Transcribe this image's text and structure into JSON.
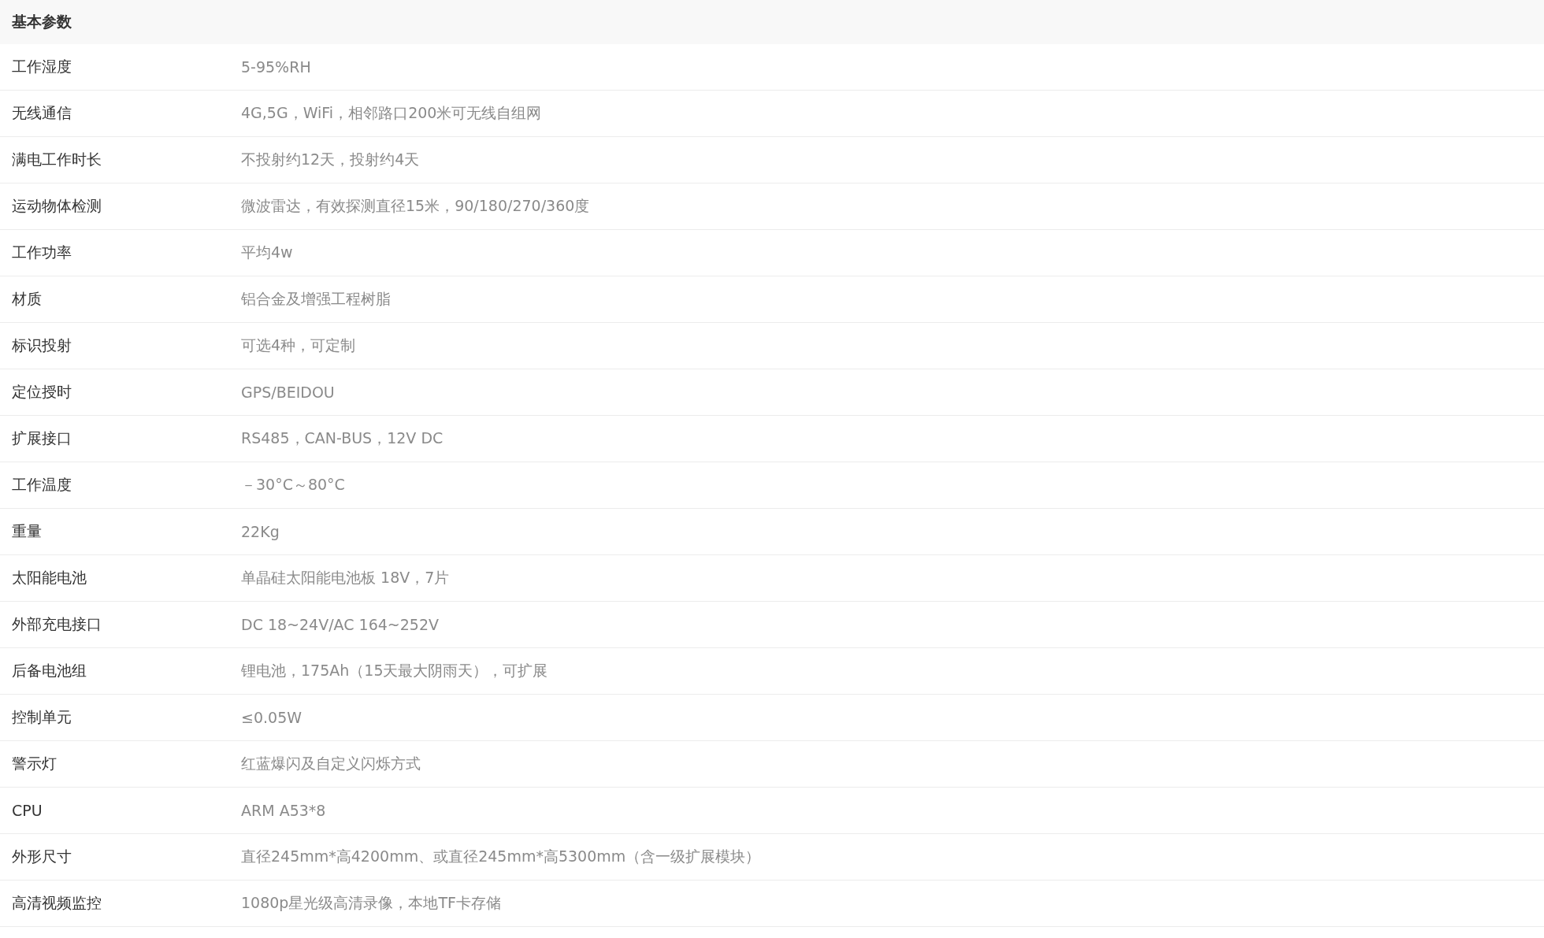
{
  "section_title": "基本参数",
  "rows": [
    {
      "label": "工作湿度",
      "value": "5-95%RH"
    },
    {
      "label": "无线通信",
      "value": "4G,5G，WiFi，相邻路口200米可无线自组网"
    },
    {
      "label": "满电工作时长",
      "value": "不投射约12天，投射约4天"
    },
    {
      "label": "运动物体检测",
      "value": "微波雷达，有效探测直径15米，90/180/270/360度"
    },
    {
      "label": "工作功率",
      "value": "平均4w"
    },
    {
      "label": "材质",
      "value": "铝合金及增强工程树脂"
    },
    {
      "label": "标识投射",
      "value": "可选4种，可定制"
    },
    {
      "label": "定位授时",
      "value": "GPS/BEIDOU"
    },
    {
      "label": "扩展接口",
      "value": "RS485，CAN-BUS，12V DC"
    },
    {
      "label": "工作温度",
      "value": "－30°C～80°C"
    },
    {
      "label": "重量",
      "value": "22Kg"
    },
    {
      "label": "太阳能电池",
      "value": "单晶硅太阳能电池板 18V，7片"
    },
    {
      "label": "外部充电接口",
      "value": "DC 18~24V/AC 164~252V"
    },
    {
      "label": "后备电池组",
      "value": "锂电池，175Ah（15天最大阴雨天），可扩展"
    },
    {
      "label": "控制单元",
      "value": "≤0.05W"
    },
    {
      "label": "警示灯",
      "value": "红蓝爆闪及自定义闪烁方式"
    },
    {
      "label": "CPU",
      "value": "ARM A53*8"
    },
    {
      "label": "外形尺寸",
      "value": "直径245mm*高4200mm、或直径245mm*高5300mm（含一级扩展模块）"
    },
    {
      "label": "高清视频监控",
      "value": "1080p星光级高清录像，本地TF卡存储"
    }
  ]
}
